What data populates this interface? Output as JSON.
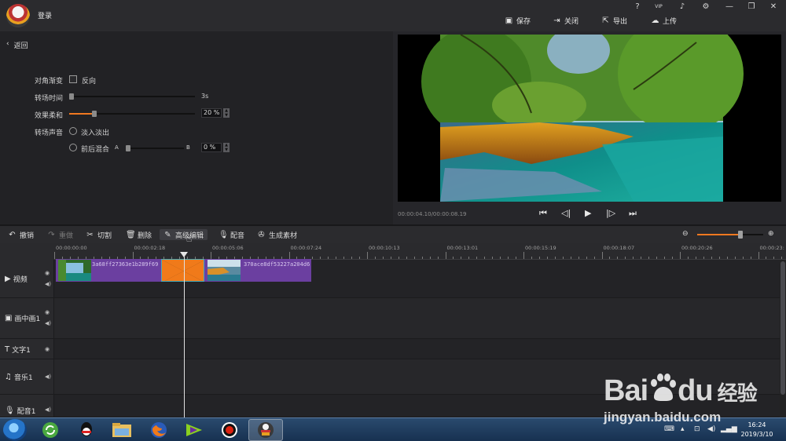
{
  "header": {
    "login": "登录",
    "window_controls": [
      "?",
      "VIP",
      "bell-icon",
      "gear-icon",
      "minimize-icon",
      "restore-icon",
      "close-icon"
    ],
    "actions": [
      {
        "label": "保存",
        "icon": "save-icon"
      },
      {
        "label": "关闭",
        "icon": "exit-icon"
      },
      {
        "label": "导出",
        "icon": "export-icon"
      },
      {
        "label": "上传",
        "icon": "cloud-upload-icon"
      }
    ]
  },
  "left_panel": {
    "back": "返回",
    "diagonal_label": "对角渐变",
    "reverse_label": "反向",
    "duration_label": "转场时间",
    "duration_value": "3s",
    "duration_level": 0.02,
    "softness_label": "效果柔和",
    "softness_value": "20 %",
    "softness_level": 0.2,
    "sound_label": "转场声音",
    "fade_label": "淡入淡出",
    "mix_label": "前后混合",
    "mix_a": "A",
    "mix_b": "B",
    "mix_value": "0 %",
    "mix_level": 0.0
  },
  "preview": {
    "timecode": "00:00:04.10/00:00:08.19",
    "controls": [
      "skip-start-icon",
      "step-back-icon",
      "play-icon",
      "step-forward-icon",
      "skip-end-icon"
    ]
  },
  "toolbar": {
    "undo": "撤销",
    "redo": "重做",
    "cut": "切割",
    "delete": "删除",
    "advanced_edit": "高级编辑",
    "dub": "配音",
    "generate": "生成素材",
    "zoom_level": 0.65
  },
  "timeline": {
    "ticks": [
      "00:00:00:00",
      "00:00:02:18",
      "00:00:05:06",
      "00:00:07:24",
      "00:00:10:13",
      "00:00:13:01",
      "00:00:15:19",
      "00:00:18:07",
      "00:00:20:26",
      "00:00:23:"
    ],
    "tracks": [
      {
        "label": "视频",
        "icons": [
          "eye-icon",
          "speaker-icon"
        ]
      },
      {
        "label": "画中画1",
        "icons": [
          "eye-icon",
          "speaker-icon"
        ]
      },
      {
        "label": "文字1",
        "icons": [
          "eye-icon"
        ]
      },
      {
        "label": "音乐1",
        "icons": [
          "speaker-icon"
        ]
      },
      {
        "label": "配音1",
        "icons": [
          "speaker-icon"
        ]
      }
    ],
    "clips": [
      {
        "name": "3a68ff27363e1b289f69"
      },
      {
        "name": "370ace8df53227a204d6"
      }
    ]
  },
  "taskbar": {
    "time": "16:24",
    "date": "2019/3/10",
    "apps": [
      "update-icon",
      "qq-icon",
      "explorer-icon",
      "firefox-icon",
      "media-player-icon",
      "recorder-icon",
      "video-editor-icon"
    ]
  },
  "watermark": {
    "brand": "Bai",
    "brand2": "du",
    "cn": "经验",
    "url": "jingyan.baidu.com"
  },
  "colors": {
    "accent": "#f07820",
    "clip": "#6b3fa0",
    "background": "#1f1f22"
  }
}
